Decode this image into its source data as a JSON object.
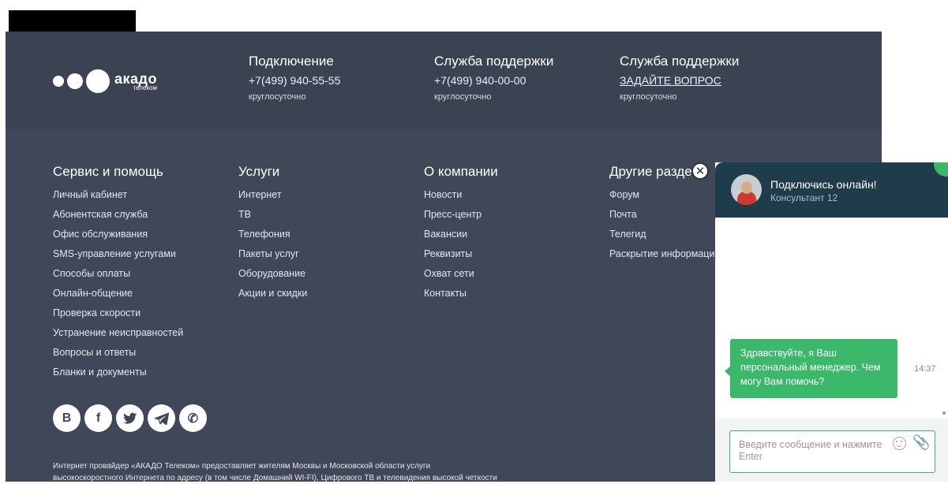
{
  "logo": {
    "name": "акадо",
    "sub": "телеком"
  },
  "contacts": [
    {
      "title": "Подключение",
      "value": "+7(499) 940-55-55",
      "note": "круглосуточно"
    },
    {
      "title": "Служба поддержки",
      "value": "+7(499) 940-00-00",
      "note": "круглосуточно"
    },
    {
      "title": "Служба поддержки",
      "value": "ЗАДАЙТЕ ВОПРОС",
      "note": "круглосуточно"
    }
  ],
  "columns": [
    {
      "title": "Сервис и помощь",
      "items": [
        "Личный кабинет",
        "Абонентская служба",
        "Офис обслуживания",
        "SMS-управление услугами",
        "Способы оплаты",
        "Онлайн-общение",
        "Проверка скорости",
        "Устранение неисправностей",
        "Вопросы и ответы",
        "Бланки и документы"
      ]
    },
    {
      "title": "Услуги",
      "items": [
        "Интернет",
        "ТВ",
        "Телефония",
        "Пакеты услуг",
        "Оборудование",
        "Акции и скидки"
      ]
    },
    {
      "title": "О компании",
      "items": [
        "Новости",
        "Пресс-центр",
        "Вакансии",
        "Реквизиты",
        "Охват сети",
        "Контакты"
      ]
    },
    {
      "title": "Другие разде",
      "items": [
        "Форум",
        "Почта",
        "Телегид",
        "Раскрытие информации"
      ]
    }
  ],
  "socials": [
    {
      "icon": "vk-icon",
      "glyph": "В"
    },
    {
      "icon": "facebook-icon",
      "glyph": "f"
    },
    {
      "icon": "twitter-icon",
      "glyph": "🐦"
    },
    {
      "icon": "telegram-icon",
      "glyph": "➤"
    },
    {
      "icon": "viber-icon",
      "glyph": "✆"
    }
  ],
  "legal": {
    "line1": "Интернет провайдер «АКАДО Телеком» предоставляет жителям Москвы и Московской области услуги",
    "line2": "высокоскоростного Интернета по адресу (в том числе Домашний WI-FI), Цифрового ТВ и телевидения высокой четкости"
  },
  "chat": {
    "close_glyph": "✕",
    "title": "Подключись онлайн!",
    "subtitle": "Консультант 12",
    "message": "Здравствуйте, я Ваш персональный менеджер. Чем могу Вам помочь?",
    "time": "14:37",
    "input_placeholder": "Введите сообщение и нажмите Enter",
    "attach_glyph": "📎"
  },
  "colors": {
    "footer_bg": "#404759",
    "chat_header": "#1f3c4a",
    "accent": "#3cb86a"
  }
}
